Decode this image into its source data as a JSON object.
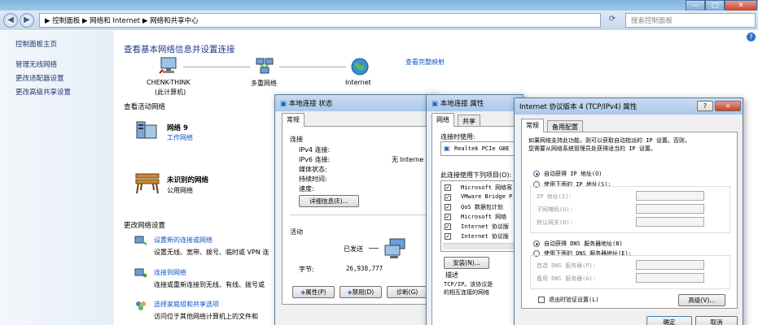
{
  "window": {
    "min": "—",
    "max": "□",
    "close": "✕"
  },
  "address": {
    "path": "▶ 控制面板 ▶ 网络和 Internet ▶ 网络和共享中心",
    "search_placeholder": "搜索控制面板",
    "back": "◀",
    "forward": "▶",
    "refresh": "⟳"
  },
  "sidebar": {
    "items": [
      "控制面板主页",
      "管理无线网络",
      "更改适配器设置",
      "更改高级共享设置"
    ]
  },
  "main": {
    "heading": "查看基本网络信息并设置连接",
    "view_full_map": "查看完整映射",
    "computer_name": "CHENK-THINK",
    "computer_sub": "(此计算机)",
    "multi_network": "多重网络",
    "internet": "Internet",
    "active_heading": "查看活动网络",
    "net1_name": "网络 9",
    "net1_type": "工作网络",
    "net2_name": "未识别的网络",
    "net2_type": "公用网络",
    "change_heading": "更改网络设置",
    "tasks": [
      {
        "title": "设置新的连接或网络",
        "desc": "设置无线、宽带、拨号、临时或 VPN 连"
      },
      {
        "title": "连接到网络",
        "desc": "连接或重新连接到无线、有线、拨号或"
      },
      {
        "title": "选择家庭组和共享选项",
        "desc": "访问位于其他网络计算机上的文件和"
      }
    ]
  },
  "status_dialog": {
    "title": "本地连接 状态",
    "tab": "常规",
    "section_conn": "连接",
    "ipv4": "IPv4 连接:",
    "ipv6": "IPv6 连接:",
    "ipv6_value": "无 Interne",
    "media": "媒体状态:",
    "duration": "持续时间:",
    "speed": "速度:",
    "details_btn": "详细信息(E)...",
    "section_activity": "活动",
    "sent_label": "已发送",
    "bytes_label": "字节:",
    "bytes_sent": "26,938,777",
    "props_btn": "属性(P)",
    "disable_btn": "禁用(D)",
    "diagnose_btn": "诊断(G)"
  },
  "props_dialog": {
    "title": "本地连接 属性",
    "tab_net": "网络",
    "tab_share": "共享",
    "connect_using": "连接时使用:",
    "adapter": "Realtek PCIe GBE",
    "items_label": "此连接使用下列项目(O):",
    "items": [
      "Microsoft 网络客",
      "VMware Bridge P",
      "QoS 数据包计划",
      "Microsoft 网络",
      "Internet 协议版",
      "Internet 协议版"
    ],
    "install_btn": "安装(N)...",
    "desc_label": "描述",
    "desc_line1": "TCP/IP。该协议是",
    "desc_line2": "的相互连接的网络"
  },
  "ipv4_dialog": {
    "title": "Internet 协议版本 4 (TCP/IPv4) 属性",
    "help": "?",
    "close": "✕",
    "tab_general": "常规",
    "tab_alt": "备用配置",
    "intro1": "如果网络支持此功能，则可以获取自动指派的 IP 设置。否则，",
    "intro2": "您需要从网络系统管理员处获得适当的 IP 设置。",
    "auto_ip": "自动获得 IP 地址(O)",
    "manual_ip": "使用下面的 IP 地址(S):",
    "ip_addr": "IP 地址(I):",
    "subnet": "子网掩码(U):",
    "gateway": "默认网关(D):",
    "auto_dns": "自动获得 DNS 服务器地址(B)",
    "manual_dns": "使用下面的 DNS 服务器地址(E):",
    "pref_dns": "首选 DNS 服务器(P):",
    "alt_dns": "备用 DNS 服务器(A):",
    "validate": "退出时验证设置(L)",
    "advanced_btn": "高级(V)...",
    "ok_btn": "确定",
    "cancel_btn": "取消"
  }
}
